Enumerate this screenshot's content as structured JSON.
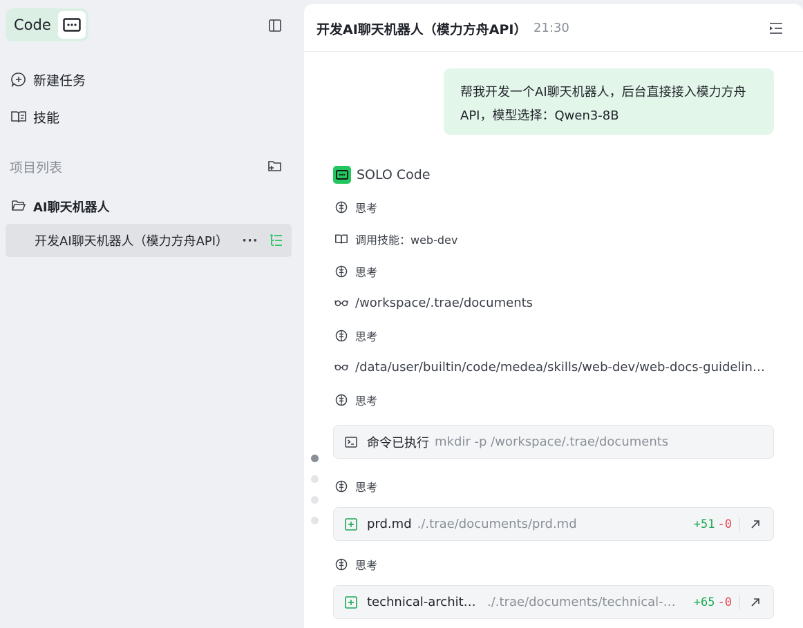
{
  "sidebar": {
    "brand_label": "Code",
    "nav": [
      {
        "label": "新建任务",
        "icon": "new-task-icon"
      },
      {
        "label": "技能",
        "icon": "skills-book-icon"
      }
    ],
    "section_title": "项目列表",
    "project": {
      "label": "AI聊天机器人",
      "icon": "folder-open-icon"
    },
    "task": {
      "label": "开发AI聊天机器人（模力方舟API）",
      "more": "···"
    }
  },
  "header": {
    "title": "开发AI聊天机器人（模力方舟API）",
    "time": "21:30"
  },
  "conversation": {
    "user_message": "帮我开发一个AI聊天机器人，后台直接接入模力方舟API，模型选择：Qwen3-8B",
    "agent_name": "SOLO Code",
    "steps": [
      {
        "type": "think",
        "text": "思考"
      },
      {
        "type": "skill",
        "text": "调用技能：web-dev"
      },
      {
        "type": "think",
        "text": "思考"
      },
      {
        "type": "read",
        "text": "/workspace/.trae/documents"
      },
      {
        "type": "think",
        "text": "思考"
      },
      {
        "type": "read",
        "text": "/data/user/builtin/code/medea/skills/web-dev/web-docs-guideline.md"
      },
      {
        "type": "think",
        "text": "思考"
      },
      {
        "type": "think",
        "text": "思考"
      },
      {
        "type": "think",
        "text": "思考"
      }
    ],
    "command_card": {
      "label": "命令已执行",
      "command": "mkdir -p /workspace/.trae/documents"
    },
    "file_cards": [
      {
        "name": "prd.md",
        "path": "./.trae/documents/prd.md",
        "added": "+51",
        "removed": "-0"
      },
      {
        "name": "technical-architecture.md",
        "path": "./.trae/documents/technical-architecture.md",
        "added": "+65",
        "removed": "-0"
      }
    ]
  },
  "colors": {
    "accent": "#22c55e",
    "user_bubble": "#e3f6ea",
    "sidebar_bg": "#eef0f3",
    "added": "#1aaa55",
    "removed": "#e5484d"
  }
}
